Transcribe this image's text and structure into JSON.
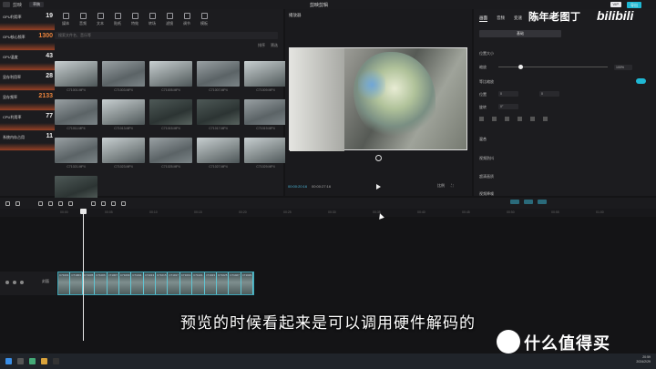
{
  "titlebar": {
    "app_name": "剪映",
    "draft_label": "草稿",
    "project_title": "剪映剪辑",
    "vip": "VIP",
    "export": "导出"
  },
  "toolbar": [
    {
      "label": "媒体",
      "icon": "media-icon"
    },
    {
      "label": "音频",
      "icon": "audio-icon"
    },
    {
      "label": "文本",
      "icon": "text-icon"
    },
    {
      "label": "贴纸",
      "icon": "sticker-icon"
    },
    {
      "label": "特效",
      "icon": "effects-icon"
    },
    {
      "label": "转场",
      "icon": "transition-icon"
    },
    {
      "label": "滤镜",
      "icon": "filter-icon"
    },
    {
      "label": "调节",
      "icon": "adjust-icon"
    },
    {
      "label": "模板",
      "icon": "template-icon"
    }
  ],
  "media": {
    "search_placeholder": "搜索文件名、音乐等",
    "filters": [
      "排序",
      "筛选"
    ],
    "thumbs": [
      {
        "name": "C71001.MP4",
        "tone": "alt"
      },
      {
        "name": "C71003.MP4",
        "tone": ""
      },
      {
        "name": "C71005.MP4",
        "tone": "alt"
      },
      {
        "name": "C71007.MP4",
        "tone": ""
      },
      {
        "name": "C71009.MP4",
        "tone": "alt"
      },
      {
        "name": "C71011.MP4",
        "tone": ""
      },
      {
        "name": "C71013.MP4",
        "tone": "alt"
      },
      {
        "name": "C71015.MP4",
        "tone": "dark"
      },
      {
        "name": "C71017.MP4",
        "tone": "dark"
      },
      {
        "name": "C71019.MP4",
        "tone": ""
      },
      {
        "name": "C71021.MP4",
        "tone": ""
      },
      {
        "name": "C71023.MP4",
        "tone": "alt"
      },
      {
        "name": "C71025.MP4",
        "tone": ""
      },
      {
        "name": "C71027.MP4",
        "tone": "alt"
      },
      {
        "name": "C71029.MP4",
        "tone": "alt"
      },
      {
        "name": "C71031.MP4",
        "tone": "dark"
      }
    ]
  },
  "gpu": [
    {
      "label": "GPU利用率",
      "value": "19"
    },
    {
      "label": "GPU核心频率",
      "value": "1300"
    },
    {
      "label": "GPU温度",
      "value": "43"
    },
    {
      "label": "显存利用率",
      "value": "28"
    },
    {
      "label": "显存频率",
      "value": "2133"
    },
    {
      "label": "CPU利用率",
      "value": "77"
    },
    {
      "label": "系统内存占用",
      "value": "11"
    }
  ],
  "player": {
    "title": "播放器",
    "time_current": "00:00:20:16",
    "time_total": "00:00:27:16",
    "ratio": "比例",
    "fullscreen": "全屏"
  },
  "inspector": {
    "tabs": [
      "画面",
      "音频",
      "变速",
      "动画",
      "调节"
    ],
    "active_tab": "画面",
    "subtab": "基础",
    "position_size": "位置大小",
    "scale_label": "缩放",
    "scale_value": "100%",
    "uniform_scale": "等比缩放",
    "position_label": "位置",
    "x_value": "0",
    "y_value": "0",
    "rotate_label": "旋转",
    "rotate_value": "0°",
    "blend": "混合",
    "stabilize": "视频防抖",
    "super_res": "超清画质",
    "noise": "视频降噪"
  },
  "watermark": "陈年老图丁",
  "bilibili": "bilibili",
  "timeline": {
    "ruler": [
      "00:00",
      "00:05",
      "00:10",
      "00:15",
      "00:20",
      "00:25",
      "00:30",
      "00:35",
      "00:40",
      "00:45",
      "00:50",
      "00:55",
      "01:00"
    ],
    "cover_label": "封面",
    "clips": [
      "C71001",
      "C71003",
      "C71005",
      "C71006",
      "C71007",
      "C71009",
      "C71011",
      "C71013",
      "C71015",
      "C71017",
      "C71019",
      "C71021",
      "C71023",
      "C71025",
      "C71027",
      "C71029"
    ]
  },
  "subtitle": "预览的时候看起来是可以调用硬件解码的",
  "brand": "什么值得买",
  "clock": {
    "time": "20:59",
    "date": "2024/2/29"
  }
}
